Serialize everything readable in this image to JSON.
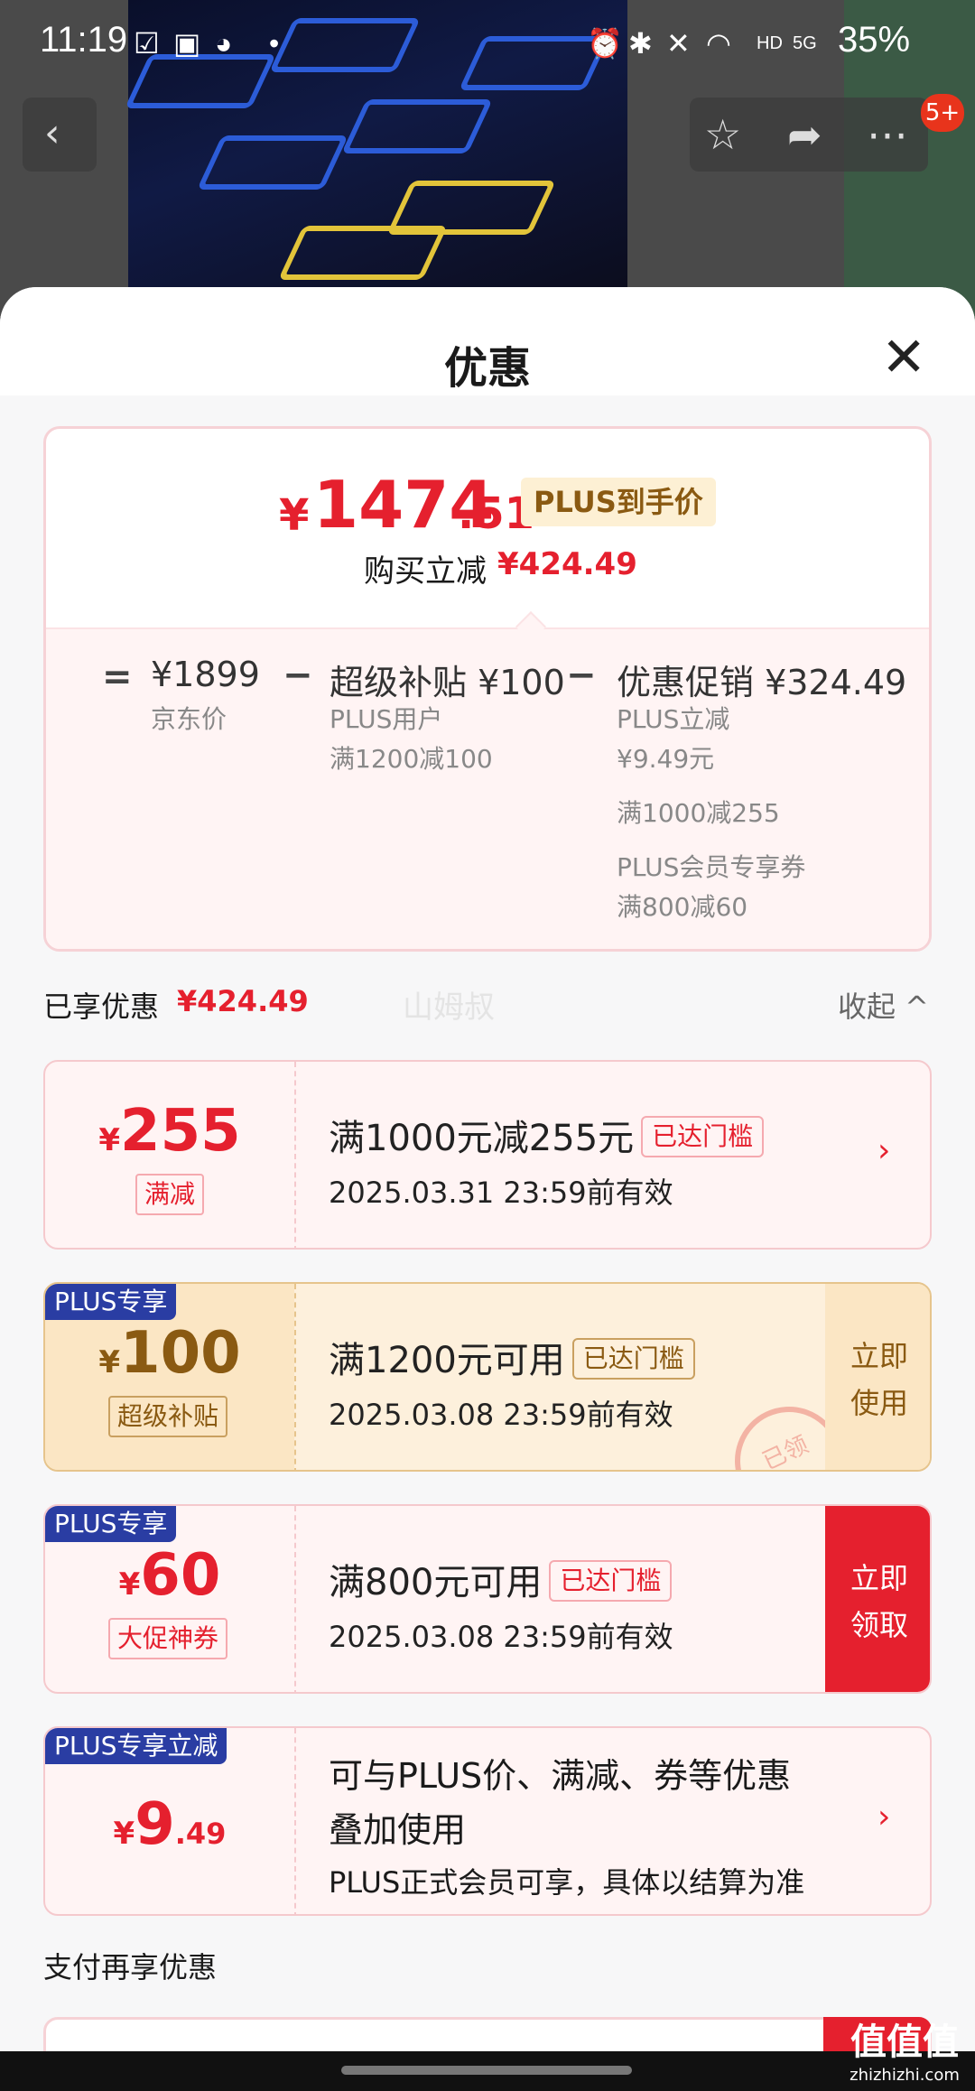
{
  "status_bar": {
    "time": "11:19",
    "battery": "35%",
    "network": "5G"
  },
  "header": {
    "badge": "5+"
  },
  "sheet": {
    "title": "优惠"
  },
  "summary": {
    "currency": "¥",
    "price_int": "1474",
    "price_dec": ".51",
    "plus_tag": "PLUS到手价",
    "instant_label": "购买立减",
    "instant_value": "¥424.49",
    "breakdown": {
      "eq": "=",
      "minus": "−",
      "base": {
        "value": "¥1899",
        "label": "京东价"
      },
      "subsidy": {
        "title": "超级补贴 ¥100",
        "line1": "PLUS用户",
        "line2": "满1200减100"
      },
      "promo": {
        "title": "优惠促销 ¥324.49",
        "line1": "PLUS立减",
        "line2": "¥9.49元",
        "line3": "满1000减255",
        "line4": "PLUS会员专享券",
        "line5": "满800减60"
      }
    }
  },
  "enjoyed": {
    "label": "已享优惠",
    "value": "¥424.49",
    "watermark": "山姆叔",
    "collapse": "收起 ^"
  },
  "coupons": [
    {
      "currency": "¥",
      "amount": "255",
      "decimal": "",
      "tag": "满减",
      "label": "",
      "condition": "满1000元减255元",
      "reach": "已达门槛",
      "validity": "2025.03.31 23:59前有效",
      "action": "",
      "arrow": "›"
    },
    {
      "currency": "¥",
      "amount": "100",
      "decimal": "",
      "tag": "超级补贴",
      "label": "PLUS专享",
      "condition": "满1200元可用",
      "reach": "已达门槛",
      "validity": "2025.03.08 23:59前有效",
      "action": "立即使用",
      "stamp": "已领"
    },
    {
      "currency": "¥",
      "amount": "60",
      "decimal": "",
      "tag": "大促神券",
      "label": "PLUS专享",
      "condition": "满800元可用",
      "reach": "已达门槛",
      "validity": "2025.03.08 23:59前有效",
      "action": "立即领取"
    },
    {
      "currency": "¥",
      "amount": "9",
      "decimal": ".49",
      "tag": "",
      "label": "PLUS专享立减",
      "line1": "可与PLUS价、满减、券等优惠",
      "line2": "叠加使用",
      "line3": "PLUS正式会员可享，具体以结算为准",
      "arrow": "›"
    }
  ],
  "pay_section": {
    "label": "支付再享优惠"
  },
  "corner_logo": {
    "big": "值值值",
    "small": "zhizhizhi.com"
  },
  "colors": {
    "accent": "#e5202e",
    "plus_blue": "#2a3da3",
    "gold": "#8a5a12"
  }
}
